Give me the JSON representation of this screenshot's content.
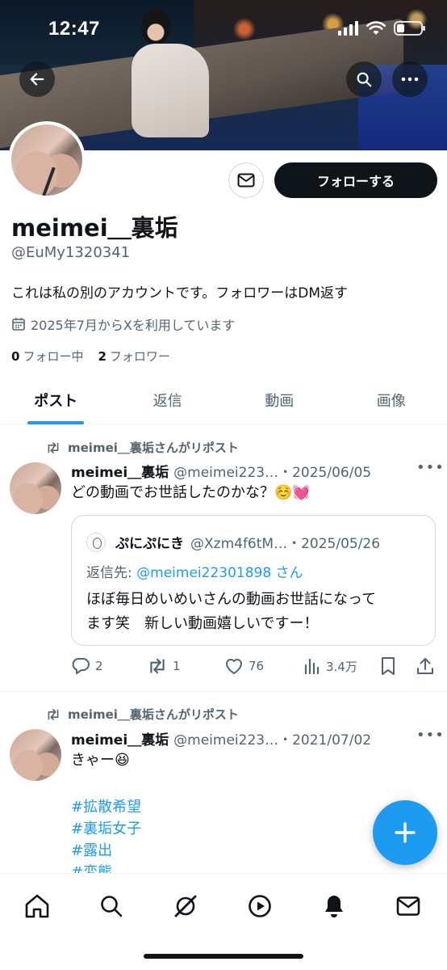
{
  "status_bar": {
    "time": "12:47"
  },
  "profile": {
    "display_name": "meimei＿裏垢",
    "handle": "@EuMy1320341",
    "bio": "これは私の別のアカウントです。フォロワーはDM返す",
    "joined": "2025年7月からXを利用しています",
    "following_count": "0",
    "following_label": "フォロー中",
    "followers_count": "2",
    "followers_label": "フォロワー",
    "follow_button": "フォローする"
  },
  "tabs": [
    {
      "label": "ポスト",
      "active": true
    },
    {
      "label": "返信",
      "active": false
    },
    {
      "label": "動画",
      "active": false
    },
    {
      "label": "画像",
      "active": false
    }
  ],
  "posts": [
    {
      "repost_label": "meimei＿裏垢さんがリポスト",
      "name": "meimei＿裏垢",
      "handle_date": "@meimei223…・2025/06/05",
      "text": "どの動画でお世話したのかな？☺️💓",
      "quote": {
        "name": "ぷにぷにき",
        "handle_date": "@Xzm4f6tM…・2025/05/26",
        "reply_prefix": "返信先: ",
        "reply_mention": "@meimei22301898",
        "reply_suffix": " さん",
        "text_line1": "ほぼ毎日めいめいさんの動画お世話になって",
        "text_line2": "ます笑　新しい動画嬉しいですー！"
      },
      "replies": "2",
      "reposts": "1",
      "likes": "76",
      "views": "3.4万"
    },
    {
      "repost_label": "meimei＿裏垢さんがリポスト",
      "name": "meimei＿裏垢",
      "handle_date": "@meimei223…・2021/07/02",
      "text": "きゃー😆",
      "hashtags": [
        "#拡散希望",
        "#裏垢女子",
        "#露出",
        "#変態"
      ]
    }
  ],
  "icons": {
    "back": "arrow-left-icon",
    "search": "search-icon",
    "more": "more-horizontal-icon",
    "mail": "envelope-icon",
    "calendar": "calendar-icon",
    "repost": "repost-icon",
    "reply": "reply-icon",
    "like": "heart-icon",
    "views": "bar-chart-icon",
    "bookmark": "bookmark-icon",
    "share": "share-icon",
    "compose": "plus-icon"
  },
  "colors": {
    "accent": "#1d9bf0",
    "text": "#0f1419",
    "muted": "#536471",
    "border": "#cfd9de"
  }
}
